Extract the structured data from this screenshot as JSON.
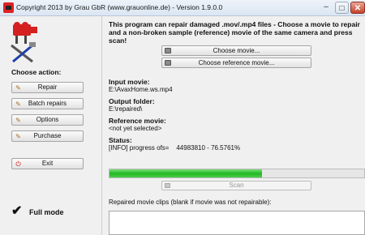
{
  "window": {
    "title": "Copyright 2013 by Grau GbR (www.grauonline.de) - Version 1.9.0.0",
    "minimize": "–",
    "maximize": "□",
    "close": "✕"
  },
  "sidebar": {
    "choose_action": "Choose action:",
    "buttons": [
      {
        "label": "Repair",
        "icon": "wrench-icon"
      },
      {
        "label": "Batch repairs",
        "icon": "batch-icon"
      },
      {
        "label": "Options",
        "icon": "options-icon"
      },
      {
        "label": "Purchase",
        "icon": "purchase-icon"
      }
    ],
    "exit_label": "Exit",
    "full_mode": "Full mode"
  },
  "main": {
    "intro": "This program can repair damaged .mov/.mp4 files - Choose a movie to repair and a non-broken sample (reference) movie of the same camera and press scan!",
    "choose_movie": "Choose movie...",
    "choose_reference": "Choose reference movie...",
    "input_movie_label": "Input movie:",
    "input_movie_value": "E:\\AvaxHome.ws.mp4",
    "output_folder_label": "Output folder:",
    "output_folder_value": "E:\\repaired\\",
    "reference_label": "Reference movie:",
    "reference_value": "<not yet selected>",
    "status_label": "Status:",
    "status_value": "[INFO] progress ofs=    44983810 - 76.5761%",
    "progress_fraction": 0.6,
    "scan_label": "Scan",
    "clips_label": "Repaired movie clips (blank if movie was not repairable):"
  },
  "colors": {
    "progress_green": "#22b822",
    "title_bar": "#dbe6f3",
    "close_red": "#c6432b"
  }
}
